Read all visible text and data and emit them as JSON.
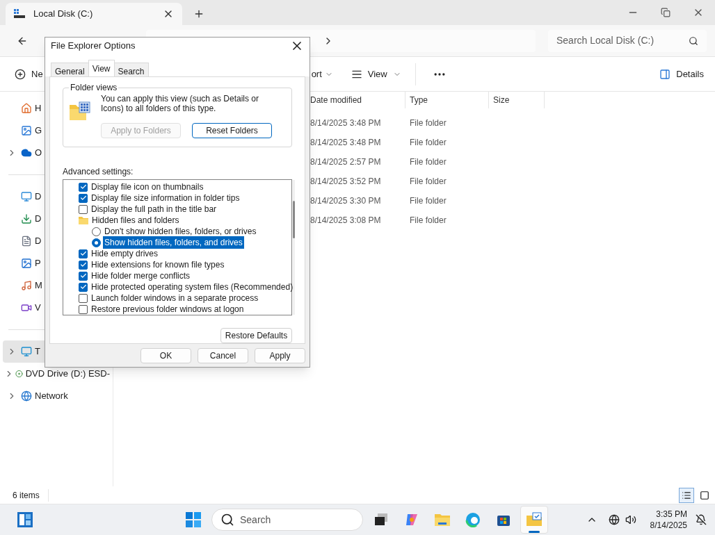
{
  "window": {
    "tab_title": "Local Disk (C:)"
  },
  "address": {
    "search_placeholder": "Search Local Disk (C:)"
  },
  "command_bar": {
    "new_label": "Ne",
    "sort_label": "ort",
    "view_label": "View",
    "details_label": "Details"
  },
  "sidebar": {
    "items": [
      {
        "label": "H",
        "kind": "home",
        "expandable": false,
        "selected": false
      },
      {
        "label": "G",
        "kind": "gallery",
        "expandable": false,
        "selected": false
      },
      {
        "label": "O",
        "kind": "cloud",
        "expandable": true,
        "selected": false
      },
      {
        "label": "D",
        "kind": "desktop",
        "expandable": false,
        "selected": false
      },
      {
        "label": "D",
        "kind": "download",
        "expandable": false,
        "selected": false
      },
      {
        "label": "D",
        "kind": "document",
        "expandable": false,
        "selected": false
      },
      {
        "label": "P",
        "kind": "picture",
        "expandable": false,
        "selected": false
      },
      {
        "label": "M",
        "kind": "music",
        "expandable": false,
        "selected": false
      },
      {
        "label": "V",
        "kind": "video",
        "expandable": false,
        "selected": false
      },
      {
        "label": "T",
        "kind": "pc",
        "expandable": true,
        "selected": true
      },
      {
        "label": "DVD Drive (D:) ESD-",
        "kind": "dvd",
        "expandable": true,
        "selected": false
      },
      {
        "label": "Network",
        "kind": "network",
        "expandable": true,
        "selected": false
      }
    ]
  },
  "table": {
    "columns": [
      "Date modified",
      "Type",
      "Size"
    ],
    "rows": [
      {
        "date": "8/14/2025 3:48 PM",
        "type": "File folder"
      },
      {
        "date": "8/14/2025 3:48 PM",
        "type": "File folder"
      },
      {
        "date": "8/14/2025 2:57 PM",
        "type": "File folder"
      },
      {
        "date": "8/14/2025 3:52 PM",
        "type": "File folder"
      },
      {
        "date": "8/14/2025 3:30 PM",
        "type": "File folder"
      },
      {
        "date": "8/14/2025 3:08 PM",
        "type": "File folder"
      }
    ]
  },
  "status_bar": {
    "count": "6 items",
    "views": [
      {
        "kind": "details",
        "selected": true
      },
      {
        "kind": "tiles",
        "selected": false
      }
    ]
  },
  "dialog": {
    "title": "File Explorer Options",
    "tabs": [
      {
        "label": "General",
        "selected": false
      },
      {
        "label": "View",
        "selected": true
      },
      {
        "label": "Search",
        "selected": false
      }
    ],
    "folder_views": {
      "legend": "Folder views",
      "description": "You can apply this view (such as Details or Icons) to all folders of this type.",
      "buttons": [
        {
          "label": "Apply to Folders",
          "disabled": true
        },
        {
          "label": "Reset Folders",
          "disabled": false
        }
      ]
    },
    "advanced_label": "Advanced settings:",
    "settings": [
      {
        "kind": "checkbox",
        "label": "Display file icon on thumbnails",
        "checked": true
      },
      {
        "kind": "checkbox",
        "label": "Display file size information in folder tips",
        "checked": true
      },
      {
        "kind": "checkbox",
        "label": "Display the full path in the title bar",
        "checked": false
      },
      {
        "kind": "group",
        "label": "Hidden files and folders"
      },
      {
        "kind": "radio",
        "label": "Don't show hidden files, folders, or drives",
        "selected": false
      },
      {
        "kind": "radio",
        "label": "Show hidden files, folders, and drives",
        "selected": true
      },
      {
        "kind": "checkbox",
        "label": "Hide empty drives",
        "checked": true
      },
      {
        "kind": "checkbox",
        "label": "Hide extensions for known file types",
        "checked": true
      },
      {
        "kind": "checkbox",
        "label": "Hide folder merge conflicts",
        "checked": true
      },
      {
        "kind": "checkbox",
        "label": "Hide protected operating system files (Recommended)",
        "checked": true
      },
      {
        "kind": "checkbox",
        "label": "Launch folder windows in a separate process",
        "checked": false
      },
      {
        "kind": "checkbox",
        "label": "Restore previous folder windows at logon",
        "checked": false
      }
    ],
    "restore_label": "Restore Defaults",
    "buttons": [
      "OK",
      "Cancel",
      "Apply"
    ]
  },
  "taskbar": {
    "search_placeholder": "Search",
    "apps": [
      {
        "kind": "taskview",
        "selected": false
      },
      {
        "kind": "copilot",
        "selected": false
      },
      {
        "kind": "explorer",
        "selected": false
      },
      {
        "kind": "edge",
        "selected": false
      },
      {
        "kind": "store",
        "selected": false
      },
      {
        "kind": "options",
        "selected": true
      }
    ],
    "time": "3:35 PM",
    "date": "8/14/2025"
  }
}
